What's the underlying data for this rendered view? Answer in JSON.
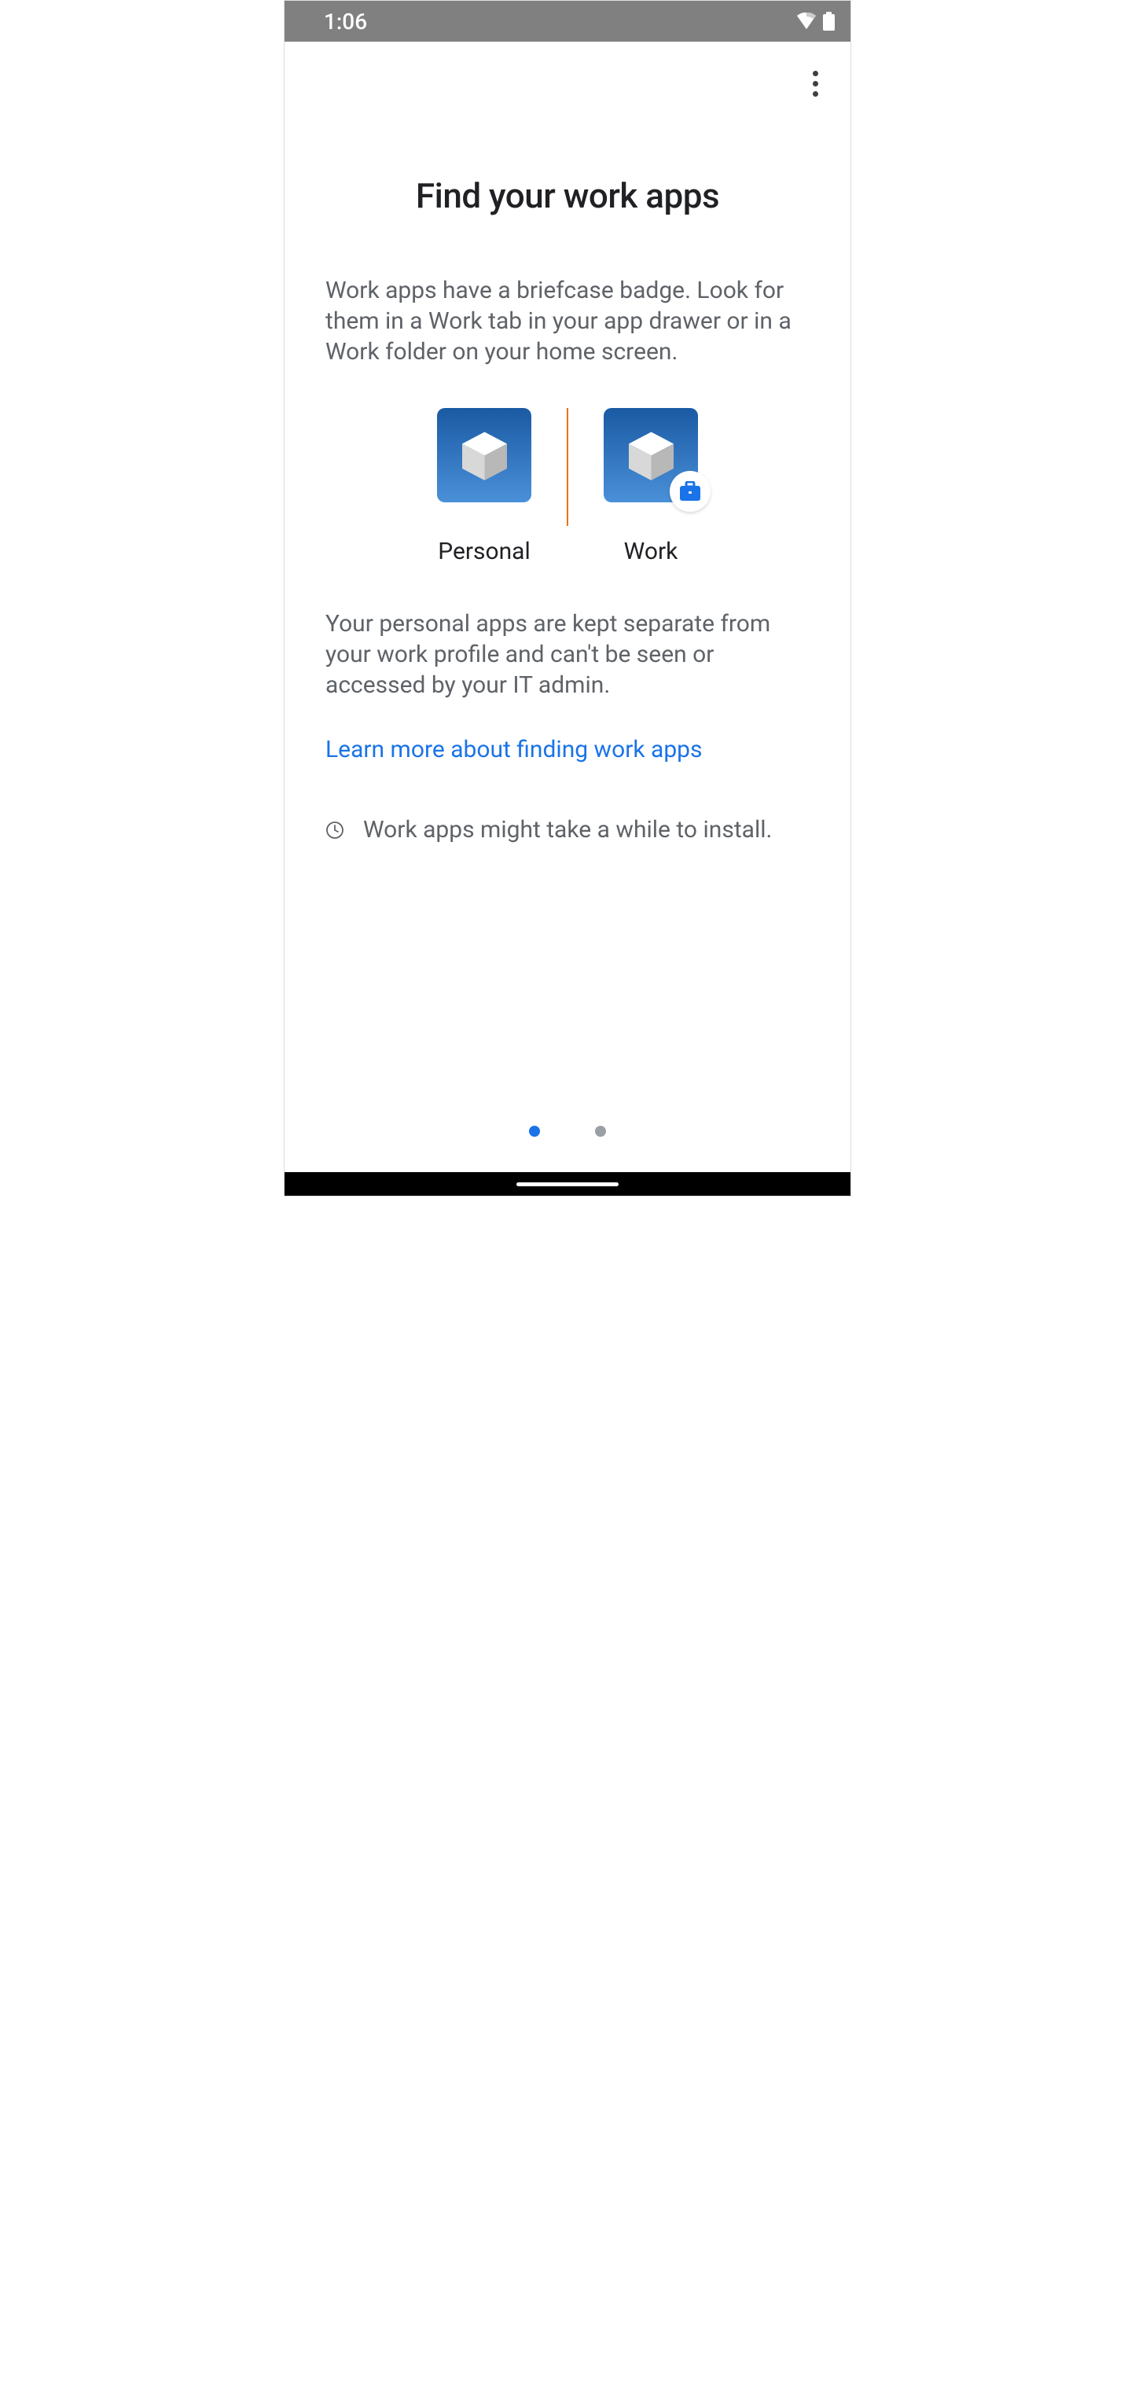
{
  "statusBar": {
    "time": "1:06"
  },
  "page": {
    "title": "Find your work apps",
    "description1": "Work apps have a briefcase badge. Look for them in a Work tab in your app drawer or in a Work folder on your home screen.",
    "personalLabel": "Personal",
    "workLabel": "Work",
    "description2": "Your personal apps are kept separate from your work profile and can't be seen or accessed by your IT admin.",
    "learnMoreText": "Learn more about finding work apps",
    "infoText": "Work apps might take a while to install."
  }
}
